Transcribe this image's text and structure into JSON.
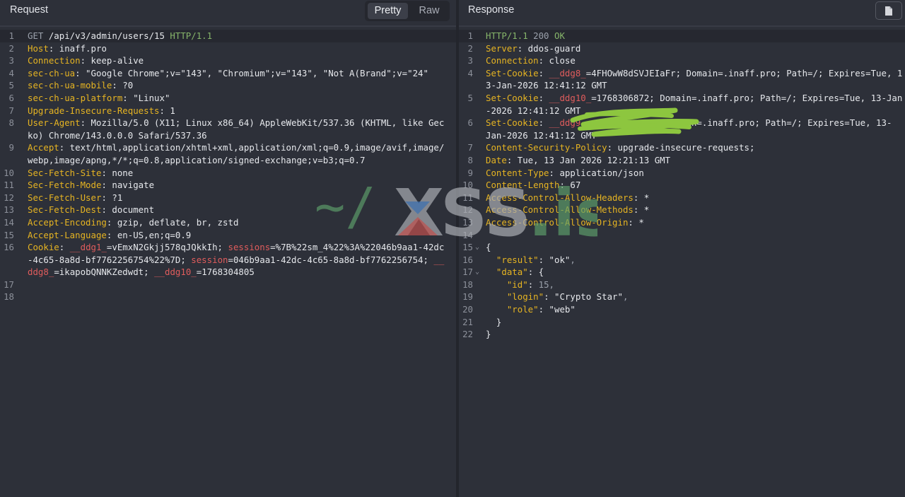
{
  "request": {
    "title": "Request",
    "view_toggle": {
      "pretty": "Pretty",
      "raw": "Raw"
    },
    "lines": [
      {
        "n": "1",
        "segs": [
          {
            "t": "GET ",
            "c": "mt"
          },
          {
            "t": "/api/v3/admin/users/15 ",
            "c": ""
          },
          {
            "t": "HTTP/1.1",
            "c": "gr"
          }
        ]
      },
      {
        "n": "2",
        "segs": [
          {
            "t": "Host",
            "c": "k"
          },
          {
            "t": ": inaff.pro",
            "c": ""
          }
        ]
      },
      {
        "n": "3",
        "segs": [
          {
            "t": "Connection",
            "c": "k"
          },
          {
            "t": ": keep-alive",
            "c": ""
          }
        ]
      },
      {
        "n": "4",
        "segs": [
          {
            "t": "sec-ch-ua",
            "c": "k"
          },
          {
            "t": ": \"Google Chrome\";v=\"143\", \"Chromium\";v=\"143\", \"Not A(Brand\";v=\"24\"",
            "c": ""
          }
        ]
      },
      {
        "n": "5",
        "segs": [
          {
            "t": "sec-ch-ua-mobile",
            "c": "k"
          },
          {
            "t": ": ?0",
            "c": ""
          }
        ]
      },
      {
        "n": "6",
        "segs": [
          {
            "t": "sec-ch-ua-platform",
            "c": "k"
          },
          {
            "t": ": \"Linux\"",
            "c": ""
          }
        ]
      },
      {
        "n": "7",
        "segs": [
          {
            "t": "Upgrade-Insecure-Requests",
            "c": "k"
          },
          {
            "t": ": 1",
            "c": ""
          }
        ]
      },
      {
        "n": "8",
        "segs": [
          {
            "t": "User-Agent",
            "c": "k"
          },
          {
            "t": ": Mozilla/5.0 (X11; Linux x86_64) AppleWebKit/537.36 (KHTML, like Gec",
            "c": ""
          }
        ]
      },
      {
        "n": "",
        "segs": [
          {
            "t": "ko) Chrome/143.0.0.0 Safari/537.36",
            "c": ""
          }
        ]
      },
      {
        "n": "9",
        "segs": [
          {
            "t": "Accept",
            "c": "k"
          },
          {
            "t": ": text/html,application/xhtml+xml,application/xml;q=0.9,image/avif,image/",
            "c": ""
          }
        ]
      },
      {
        "n": "",
        "segs": [
          {
            "t": "webp,image/apng,*/*;q=0.8,application/signed-exchange;v=b3;q=0.7",
            "c": ""
          }
        ]
      },
      {
        "n": "10",
        "segs": [
          {
            "t": "Sec-Fetch-Site",
            "c": "k"
          },
          {
            "t": ": none",
            "c": ""
          }
        ]
      },
      {
        "n": "11",
        "segs": [
          {
            "t": "Sec-Fetch-Mode",
            "c": "k"
          },
          {
            "t": ": navigate",
            "c": ""
          }
        ]
      },
      {
        "n": "12",
        "segs": [
          {
            "t": "Sec-Fetch-User",
            "c": "k"
          },
          {
            "t": ": ?1",
            "c": ""
          }
        ]
      },
      {
        "n": "13",
        "segs": [
          {
            "t": "Sec-Fetch-Dest",
            "c": "k"
          },
          {
            "t": ": document",
            "c": ""
          }
        ]
      },
      {
        "n": "14",
        "segs": [
          {
            "t": "Accept-Encoding",
            "c": "k"
          },
          {
            "t": ": gzip, deflate, br, zstd",
            "c": ""
          }
        ]
      },
      {
        "n": "15",
        "segs": [
          {
            "t": "Accept-Language",
            "c": "k"
          },
          {
            "t": ": en-US,en;q=0.9",
            "c": ""
          }
        ]
      },
      {
        "n": "16",
        "segs": [
          {
            "t": "Cookie",
            "c": "k"
          },
          {
            "t": ": ",
            "c": ""
          },
          {
            "t": "__ddg1_",
            "c": "ck"
          },
          {
            "t": "=vEmxN2Gkjj578qJQkkIh; ",
            "c": ""
          },
          {
            "t": "sessions",
            "c": "ck"
          },
          {
            "t": "=%7B%22sm_4%22%3A%22046b9aa1-42dc",
            "c": ""
          }
        ]
      },
      {
        "n": "",
        "segs": [
          {
            "t": "-4c65-8a8d-bf7762256754%22%7D; ",
            "c": ""
          },
          {
            "t": "session",
            "c": "ck"
          },
          {
            "t": "=046b9aa1-42dc-4c65-8a8d-bf7762256754; ",
            "c": ""
          },
          {
            "t": "__",
            "c": "ck"
          }
        ]
      },
      {
        "n": "",
        "segs": [
          {
            "t": "ddg8_",
            "c": "ck"
          },
          {
            "t": "=ikapobQNNKZedwdt; ",
            "c": ""
          },
          {
            "t": "__ddg10_",
            "c": "ck"
          },
          {
            "t": "=1768304805",
            "c": ""
          }
        ]
      },
      {
        "n": "17",
        "segs": []
      },
      {
        "n": "18",
        "segs": []
      }
    ]
  },
  "response": {
    "title": "Response",
    "lines": [
      {
        "n": "1",
        "segs": [
          {
            "t": "HTTP/1.1 ",
            "c": "gr"
          },
          {
            "t": "200 ",
            "c": "mt"
          },
          {
            "t": "OK",
            "c": "gr"
          }
        ]
      },
      {
        "n": "2",
        "segs": [
          {
            "t": "Server",
            "c": "k"
          },
          {
            "t": ": ddos-guard",
            "c": ""
          }
        ]
      },
      {
        "n": "3",
        "segs": [
          {
            "t": "Connection",
            "c": "k"
          },
          {
            "t": ": close",
            "c": ""
          }
        ]
      },
      {
        "n": "4",
        "segs": [
          {
            "t": "Set-Cookie",
            "c": "k"
          },
          {
            "t": ": ",
            "c": ""
          },
          {
            "t": "__ddg8_",
            "c": "ck"
          },
          {
            "t": "=4FHOwW8dSVJEIaFr; Domain=.inaff.pro; Path=/; Expires=Tue, 1",
            "c": ""
          }
        ]
      },
      {
        "n": "",
        "segs": [
          {
            "t": "3-Jan-2026 12:41:12 GMT",
            "c": ""
          }
        ]
      },
      {
        "n": "5",
        "segs": [
          {
            "t": "Set-Cookie",
            "c": "k"
          },
          {
            "t": ": ",
            "c": ""
          },
          {
            "t": "__ddg10_",
            "c": "ck"
          },
          {
            "t": "=1768306872; Domain=.inaff.pro; Path=/; Expires=Tue, 13-Jan",
            "c": ""
          }
        ]
      },
      {
        "n": "",
        "segs": [
          {
            "t": "-2026 12:41:12 GMT",
            "c": ""
          }
        ]
      },
      {
        "n": "6",
        "segs": [
          {
            "t": "Set-Cookie",
            "c": "k"
          },
          {
            "t": ": ",
            "c": ""
          },
          {
            "t": "__ddg9",
            "c": "ck"
          },
          {
            "t": "              ; Domain=.inaff.pro; Path=/; Expires=Tue, 13-",
            "c": ""
          }
        ]
      },
      {
        "n": "",
        "segs": [
          {
            "t": "Jan-2026 12:41:12 GMT",
            "c": ""
          }
        ]
      },
      {
        "n": "7",
        "segs": [
          {
            "t": "Content-Security-Policy",
            "c": "k"
          },
          {
            "t": ": upgrade-insecure-requests;",
            "c": ""
          }
        ]
      },
      {
        "n": "8",
        "segs": [
          {
            "t": "Date",
            "c": "k"
          },
          {
            "t": ": Tue, 13 Jan 2026 12:21:13 GMT",
            "c": ""
          }
        ]
      },
      {
        "n": "9",
        "segs": [
          {
            "t": "Content-Type",
            "c": "k"
          },
          {
            "t": ": application/json",
            "c": ""
          }
        ]
      },
      {
        "n": "10",
        "segs": [
          {
            "t": "Content-Length",
            "c": "k"
          },
          {
            "t": ": 67",
            "c": ""
          }
        ]
      },
      {
        "n": "11",
        "segs": [
          {
            "t": "Access-Control-Allow-Headers",
            "c": "k"
          },
          {
            "t": ": *",
            "c": ""
          }
        ]
      },
      {
        "n": "12",
        "segs": [
          {
            "t": "Access-Control-Allow-Methods",
            "c": "k"
          },
          {
            "t": ": *",
            "c": ""
          }
        ]
      },
      {
        "n": "13",
        "segs": [
          {
            "t": "Access-Control-Allow-Origin",
            "c": "k"
          },
          {
            "t": ": *",
            "c": ""
          }
        ]
      },
      {
        "n": "14",
        "segs": []
      },
      {
        "n": "15",
        "fold": true,
        "segs": [
          {
            "t": "{",
            "c": ""
          }
        ]
      },
      {
        "n": "16",
        "segs": [
          {
            "t": "  \"result\"",
            "c": "jk"
          },
          {
            "t": ": \"ok\"",
            "c": ""
          },
          {
            "t": ",",
            "c": "jp"
          }
        ]
      },
      {
        "n": "17",
        "fold": true,
        "segs": [
          {
            "t": "  \"data\"",
            "c": "jk"
          },
          {
            "t": ": {",
            "c": ""
          }
        ]
      },
      {
        "n": "18",
        "segs": [
          {
            "t": "    \"id\"",
            "c": "jk"
          },
          {
            "t": ": ",
            "c": ""
          },
          {
            "t": "15",
            "c": "jn"
          },
          {
            "t": ",",
            "c": "jp"
          }
        ]
      },
      {
        "n": "19",
        "segs": [
          {
            "t": "    \"login\"",
            "c": "jk"
          },
          {
            "t": ": \"Crypto Star\"",
            "c": ""
          },
          {
            "t": ",",
            "c": "jp"
          }
        ]
      },
      {
        "n": "20",
        "segs": [
          {
            "t": "    \"role\"",
            "c": "jk"
          },
          {
            "t": ": \"web\"",
            "c": ""
          }
        ]
      },
      {
        "n": "21",
        "segs": [
          {
            "t": "  }",
            "c": ""
          }
        ]
      },
      {
        "n": "22",
        "segs": [
          {
            "t": "}",
            "c": ""
          }
        ]
      }
    ]
  },
  "watermark": {
    "text": "~/ XSS.is",
    "colors": {
      "green": "#5fa36b",
      "gray": "#a9acb2",
      "blue": "#3a6fb0",
      "red": "#c0504d"
    }
  },
  "colors": {
    "key": "#e6b422",
    "cookie": "#e05c5c",
    "protocol": "#86b56a",
    "redaction": "#8dc63f"
  },
  "icons": {
    "copy": "document-icon",
    "fold": "chevron-down-icon"
  }
}
